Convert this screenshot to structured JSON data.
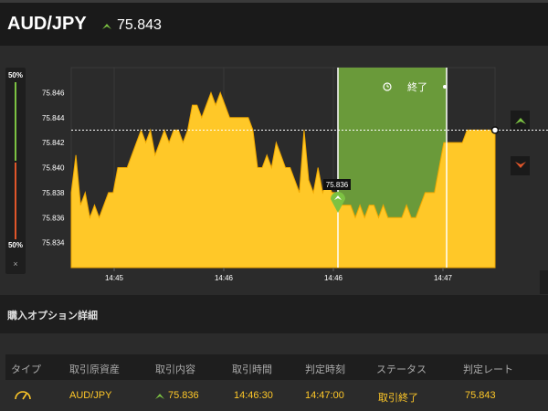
{
  "header": {
    "pair": "AUD/JPY",
    "rate": "75.843",
    "up_color": "#7cc242"
  },
  "gauge": {
    "top_label": "50%",
    "bottom_label": "50%",
    "close_label": "×",
    "high_percent": 50,
    "low_percent": 50
  },
  "chart": {
    "expiry_label": "終了",
    "entry_label": "75.836",
    "strike_level": 75.843,
    "colors": {
      "area": "#ffc828",
      "area_line": "#f0a800",
      "expiry_zone": "#6a9a3a",
      "grid": "#3a3a3a"
    }
  },
  "chart_data": {
    "type": "area",
    "ylim": [
      75.832,
      75.848
    ],
    "y_ticks": [
      "75.846",
      "75.844",
      "75.842",
      "75.840",
      "75.838",
      "75.836",
      "75.834"
    ],
    "x_ticks": [
      "14:45",
      "14:46",
      "14:46",
      "14:47"
    ],
    "series": [
      {
        "values": [
          75.838,
          75.841,
          75.837,
          75.838,
          75.836,
          75.837,
          75.836,
          75.837,
          75.838,
          75.838,
          75.84,
          75.84,
          75.84,
          75.841,
          75.842,
          75.843,
          75.842,
          75.843,
          75.841,
          75.842,
          75.843,
          75.842,
          75.843,
          75.843,
          75.842,
          75.843,
          75.845,
          75.845,
          75.844,
          75.845,
          75.846,
          75.845,
          75.846,
          75.845,
          75.844,
          75.844,
          75.844,
          75.844,
          75.844,
          75.843,
          75.84,
          75.84,
          75.841,
          75.84,
          75.842,
          75.841,
          75.84,
          75.84,
          75.839,
          75.838,
          75.843,
          75.839,
          75.838,
          75.84,
          75.838,
          75.839,
          75.838,
          75.838,
          75.837,
          75.837,
          75.837,
          75.836,
          75.837,
          75.836,
          75.837,
          75.837,
          75.836,
          75.837,
          75.836,
          75.836,
          75.836,
          75.836,
          75.837,
          75.836,
          75.836,
          75.837,
          75.838,
          75.838,
          75.838,
          75.84,
          75.842,
          75.842,
          75.842,
          75.842,
          75.842,
          75.843,
          75.843,
          75.843,
          75.843,
          75.843,
          75.843,
          75.843
        ]
      }
    ]
  },
  "details": {
    "title": "購入オプション詳細",
    "columns": [
      "タイプ",
      "取引原資産",
      "取引内容",
      "取引時間",
      "判定時刻",
      "ステータス",
      "判定レート"
    ],
    "row": {
      "asset": "AUD/JPY",
      "entry_rate": "75.836",
      "trade_time": "14:46:30",
      "judge_time": "14:47:00",
      "status": "取引終了",
      "judge_rate": "75.843"
    }
  }
}
